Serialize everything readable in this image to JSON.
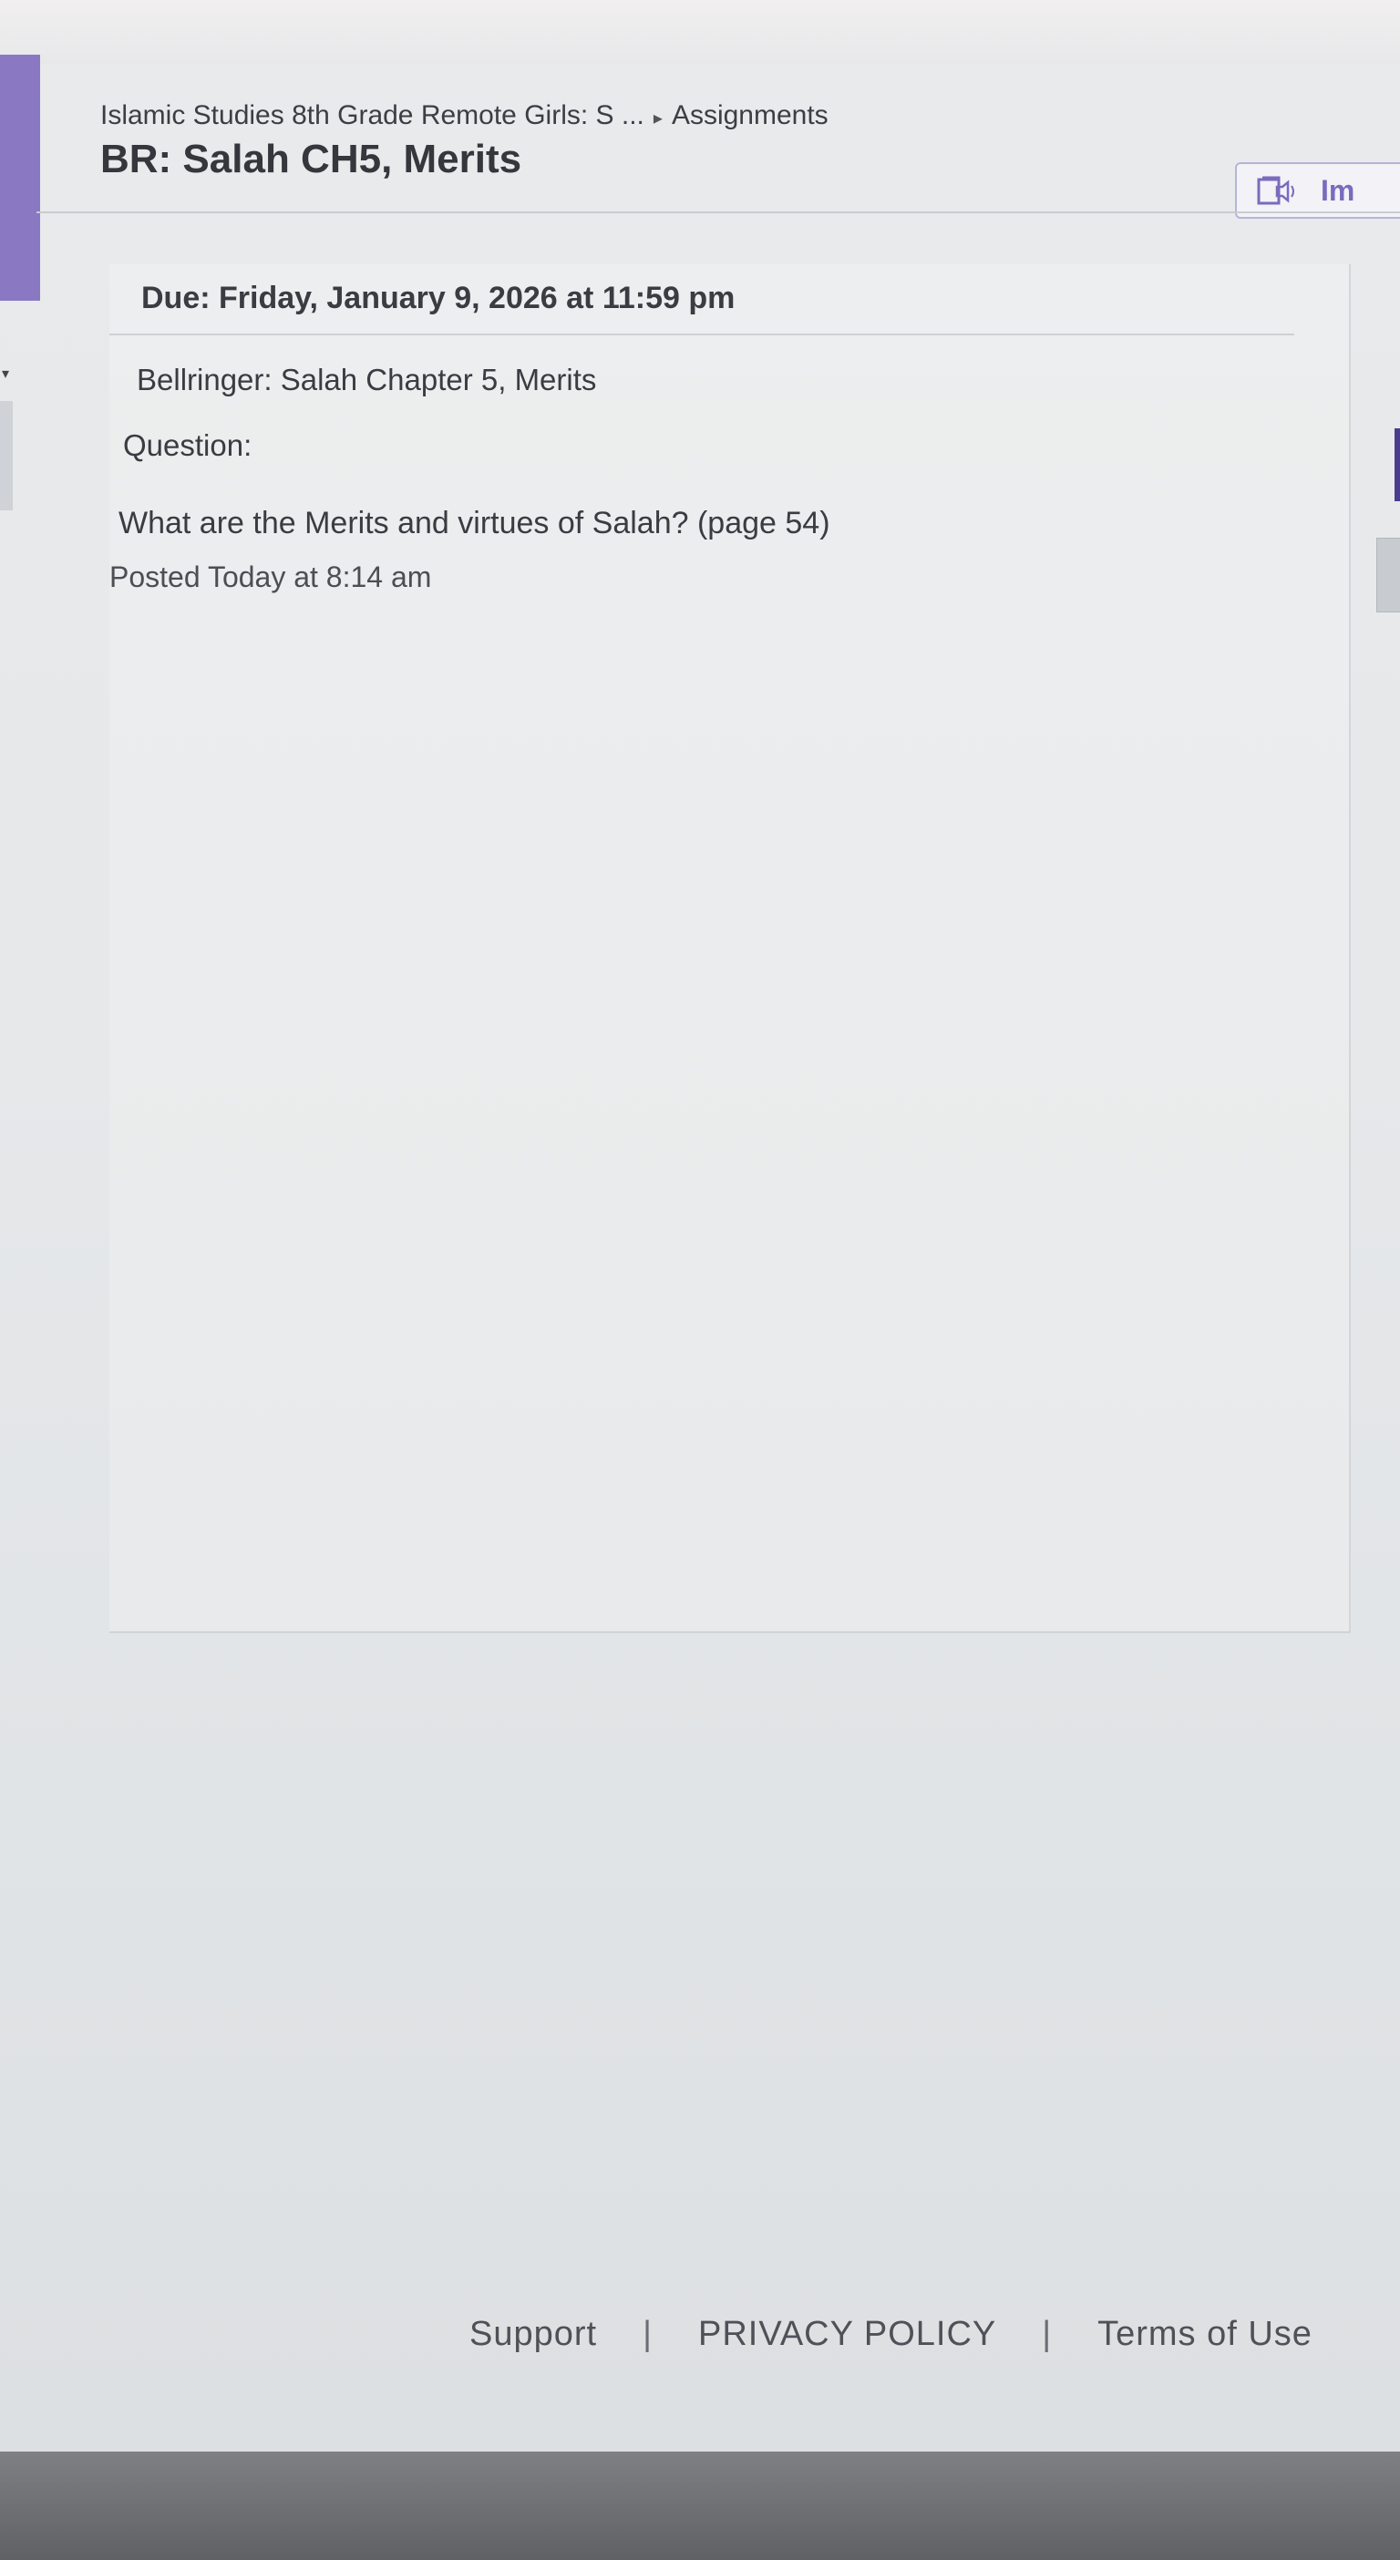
{
  "breadcrumb": {
    "course": "Islamic Studies 8th Grade Remote Girls: S ...",
    "separator": "▸",
    "section": "Assignments"
  },
  "page": {
    "title": "BR: Salah CH5, Merits"
  },
  "toolbar": {
    "immersive_reader_label": "Im",
    "immersive_reader_icon": "immersive-reader-icon"
  },
  "assignment": {
    "due": "Due: Friday, January 9, 2026 at 11:59 pm",
    "title": "Bellringer: Salah Chapter 5, Merits",
    "question_label": "Question:",
    "question_text": "What are the Merits and virtues of Salah? (page 54)",
    "posted": "Posted Today at 8:14 am"
  },
  "footer": {
    "support": "Support",
    "divider": "|",
    "privacy": "PRIVACY POLICY",
    "terms": "Terms of Use"
  },
  "colors": {
    "accent": "#8a78c3",
    "accent_dark": "#4a3d8f",
    "immersive_text": "#7a6bbd"
  }
}
